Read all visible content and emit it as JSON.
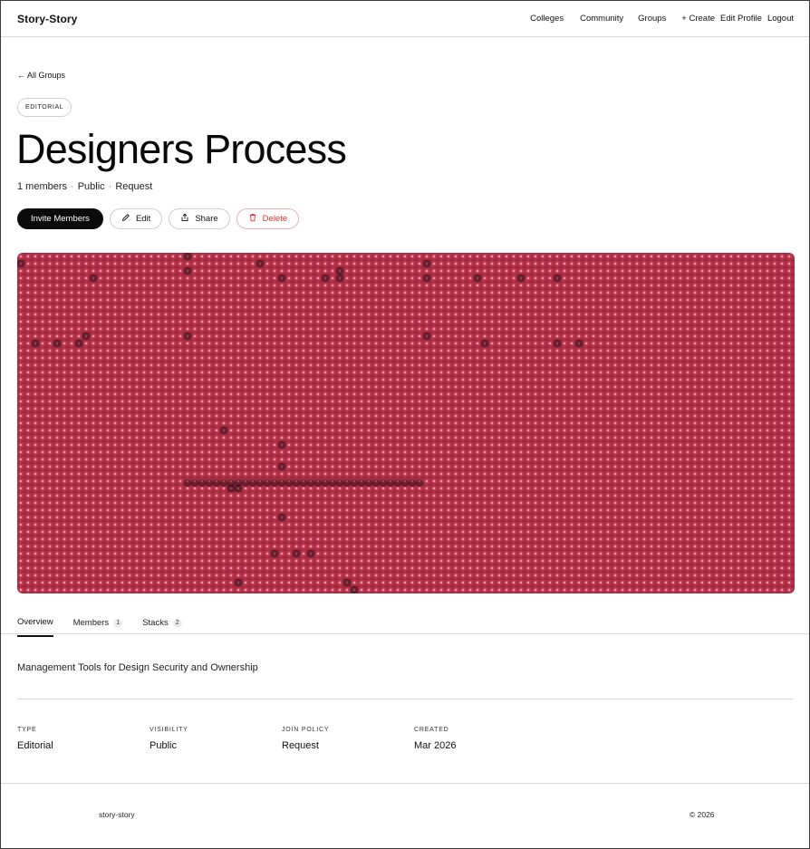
{
  "header": {
    "brand": "Story-Story",
    "nav": {
      "colleges": "Colleges",
      "community": "Community",
      "groups": "Groups",
      "create": "+ Create",
      "edit_profile": "Edit Profile",
      "logout": "Logout"
    }
  },
  "group": {
    "back_link": "← All Groups",
    "type_tag": "EDITORIAL",
    "title": "Designers Process",
    "members_count": "1 members",
    "visibility": "Public",
    "join": "Request",
    "meta_separator": "·",
    "actions": {
      "invite": "Invite Members",
      "edit": "Edit",
      "share": "Share",
      "delete": "Delete"
    },
    "cover": {
      "base_color": "#b9344a",
      "dot_color": "#f4b8c5"
    }
  },
  "tabs": [
    {
      "label": "Overview",
      "count": ""
    },
    {
      "label": "Members",
      "count": "1"
    },
    {
      "label": "Stacks",
      "count": "2"
    }
  ],
  "overview": {
    "description": "Management Tools for Design Security and Ownership",
    "details": [
      {
        "label": "TYPE",
        "value": "Editorial"
      },
      {
        "label": "VISIBILITY",
        "value": "Public"
      },
      {
        "label": "JOIN POLICY",
        "value": "Request"
      },
      {
        "label": "CREATED",
        "value": "Mar 2026"
      }
    ]
  },
  "footer": {
    "brand": "story-story",
    "copyright": "© 2026"
  },
  "colors": {
    "primary_button": "#0b0b0b",
    "danger": "#e0332f"
  }
}
